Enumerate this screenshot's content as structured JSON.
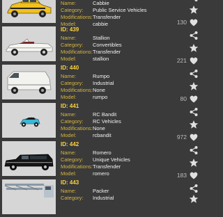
{
  "labels": {
    "name": "Name:",
    "category": "Category:",
    "modifications": "Modifications:",
    "model": "Model:"
  },
  "vehicles": [
    {
      "id_text": "",
      "name": "Cabbie",
      "category": "Public Service Vehicles",
      "modifications": "Transfender",
      "model": "cabbie",
      "likes": "130",
      "image": "taxi-car-image"
    },
    {
      "id_text": "ID: 439",
      "name": "Stallion",
      "category": "Convertibles",
      "modifications": "Transfender",
      "model": "stallion",
      "likes": "221",
      "image": "convertible-car-image"
    },
    {
      "id_text": "ID: 440",
      "name": "Rumpo",
      "category": "Industrial",
      "modifications": "None",
      "model": "rumpo",
      "likes": "80",
      "image": "van-image"
    },
    {
      "id_text": "ID: 441",
      "name": "RC Bandit",
      "category": "RC Vehicles",
      "modifications": "None",
      "model": "rcbandit",
      "likes": "972",
      "image": "rc-car-image"
    },
    {
      "id_text": "ID: 442",
      "name": "Romero",
      "category": "Unique Vehicles",
      "modifications": "Transfender",
      "model": "romero",
      "likes": "183",
      "image": "hearse-image"
    },
    {
      "id_text": "ID: 443",
      "name": "Packer",
      "category": "Industrial",
      "modifications": "",
      "model": "",
      "likes": "",
      "image": "packer-truck-image"
    }
  ],
  "colors": {
    "background": "#3a3a3a",
    "accent": "#ffd23a",
    "label": "#d7b640",
    "value": "#f2f2f2",
    "icon": "#e0e0e0"
  }
}
